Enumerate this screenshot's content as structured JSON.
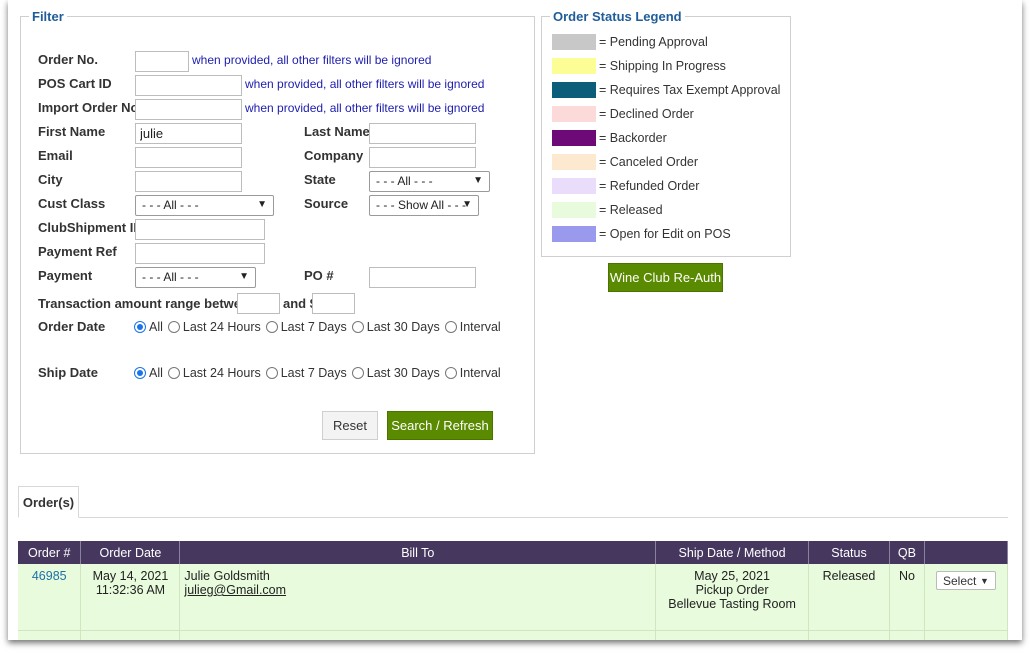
{
  "filter": {
    "legend": "Filter",
    "hint_ignore": "when provided, all other filters will be ignored",
    "order_no_label": "Order No.",
    "pos_cart_label": "POS Cart ID",
    "import_order_label": "Import Order No.",
    "first_name_label": "First Name",
    "first_name_value": "julie",
    "last_name_label": "Last Name",
    "email_label": "Email",
    "company_label": "Company",
    "city_label": "City",
    "state_label": "State",
    "state_value": "- - - All - - -",
    "cust_class_label": "Cust Class",
    "cust_class_value": "- - - All - - -",
    "source_label": "Source",
    "source_value": "- - - Show All - - -",
    "club_shipment_label": "ClubShipment ID",
    "payment_ref_label": "Payment Ref",
    "payment_label": "Payment",
    "payment_value": "- - - All - - -",
    "po_label": "PO #",
    "txn_range_label": "Transaction amount range between: $",
    "txn_and_label": "and $",
    "order_date_label": "Order Date",
    "ship_date_label": "Ship Date",
    "date_options": [
      "All",
      "Last 24 Hours",
      "Last 7 Days",
      "Last 30 Days",
      "Interval"
    ],
    "order_date_selected": "All",
    "ship_date_selected": "All",
    "reset_label": "Reset",
    "search_label": "Search / Refresh"
  },
  "legend": {
    "title": "Order Status Legend",
    "items": [
      {
        "label": "= Pending Approval",
        "color": "#c8c8c8"
      },
      {
        "label": "= Shipping In Progress",
        "color": "#fdfd96"
      },
      {
        "label": "= Requires Tax Exempt Approval",
        "color": "#0b5d7a"
      },
      {
        "label": "= Declined Order",
        "color": "#fddada"
      },
      {
        "label": "= Backorder",
        "color": "#6e0a78"
      },
      {
        "label": "= Canceled Order",
        "color": "#fde8d0"
      },
      {
        "label": "= Refunded Order",
        "color": "#eadcfb"
      },
      {
        "label": "= Released",
        "color": "#e8fbdc"
      },
      {
        "label": "= Open for Edit on POS",
        "color": "#9999ee"
      }
    ],
    "reauth_label": "Wine Club Re-Auth"
  },
  "orders": {
    "tab_label": "Order(s)",
    "columns": [
      "Order #",
      "Order Date",
      "Bill To",
      "Ship Date / Method",
      "Status",
      "QB",
      ""
    ],
    "rows": [
      {
        "order_no": "46985",
        "date": "May 14, 2021",
        "time": "11:32:36 AM",
        "bill_name": "Julie Goldsmith",
        "bill_email": "julieg@Gmail.com",
        "ship_date": "May 25, 2021",
        "ship_method": "Pickup Order",
        "ship_location": "Bellevue Tasting Room",
        "status": "Released",
        "qb": "No",
        "action_label": "Select"
      }
    ]
  }
}
